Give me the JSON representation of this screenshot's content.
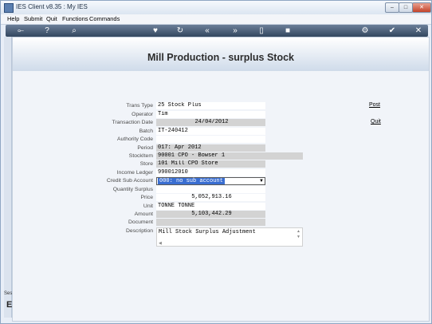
{
  "window": {
    "title": "IES Client v8.35 : My IES",
    "controls": {
      "minimize": "–",
      "maximize": "□",
      "close": "✕"
    }
  },
  "menubar": [
    "Help",
    "Submit",
    "Quit",
    "Functions",
    "Commands"
  ],
  "toolbar_icons": [
    "back-icon",
    "info-icon",
    "search-icon",
    "heart-icon",
    "refresh-icon",
    "rewind-icon",
    "fast-forward-icon",
    "save-icon",
    "stop-icon",
    "settings-icon",
    "check-icon",
    "close-icon"
  ],
  "toolbar_glyphs": {
    "back": "⟜",
    "info": "?",
    "search": "⌕",
    "heart": "♥",
    "refresh": "↻",
    "rewind": "«",
    "forward": "»",
    "save": "▯",
    "stop": "■",
    "settings": "⚙",
    "check": "✔",
    "close": "✕"
  },
  "side": {
    "label1": "Ses",
    "label2": "E"
  },
  "page": {
    "title": "Mill Production - surplus Stock"
  },
  "actions": {
    "post": "Post",
    "quit": "Quit"
  },
  "form": {
    "labels": {
      "trans_type": "Trans Type",
      "operator": "Operator",
      "transaction_date": "Transaction Date",
      "batch": "Batch",
      "authority_code": "Authority Code",
      "period": "Period",
      "stockitem": "StockItem",
      "store": "Store",
      "income_ledger": "Income Ledger",
      "credit_sub_account": "Credit Sub Account",
      "quantity_surplus": "Quantity Surplus",
      "price": "Price",
      "unit": "Unit",
      "amount": "Amount",
      "document": "Document",
      "description": "Description"
    },
    "values": {
      "trans_type": "25 Stock Plus",
      "operator": "Tim",
      "transaction_date": "24/04/2012",
      "batch": "IT-240412",
      "authority_code": "",
      "period": "017: Apr 2012",
      "stockitem": "90001 CPO - Bowser 1",
      "store": "101 Mill CPO Store",
      "income_ledger": "990012010",
      "credit_sub_account": "000: no sub account",
      "quantity_surplus": "",
      "price": "5,052,913.16",
      "unit": "TONNE TONNE",
      "amount": "5,103,442.29",
      "document": "",
      "description": "Mill Stock Surplus Adjustment"
    }
  }
}
